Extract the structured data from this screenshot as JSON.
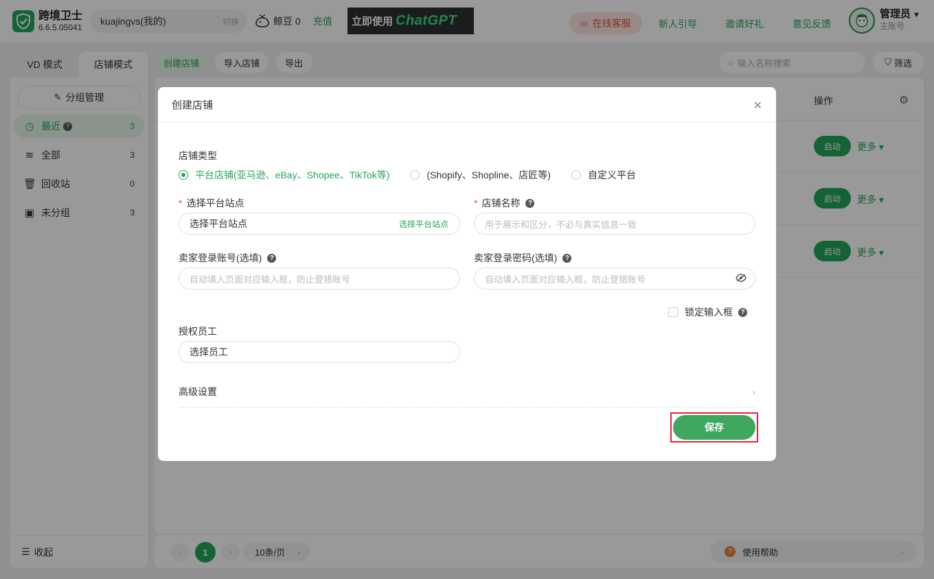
{
  "app": {
    "name": "跨境卫士",
    "version": "6.6.5.05041"
  },
  "account": {
    "name": "kuajingvs(我的)",
    "switch_label": "切换"
  },
  "whale": {
    "label": "鲸豆 0",
    "recharge": "充值"
  },
  "banner": {
    "prefix": "立即使用",
    "brand": "ChatGPT"
  },
  "header": {
    "service_label": "在线客服",
    "guide_label": "新人引导",
    "invite_label": "邀请好礼",
    "feedback_label": "意见反馈",
    "user_name": "管理员",
    "user_role": "主账号"
  },
  "mode_tabs": [
    {
      "label": "VD 模式"
    },
    {
      "label": "店铺模式"
    }
  ],
  "sidebar": {
    "group_manage": "分组管理",
    "items": [
      {
        "label": "最近",
        "count": "3"
      },
      {
        "label": "全部",
        "count": "3"
      },
      {
        "label": "回收站",
        "count": "0"
      },
      {
        "label": "未分组",
        "count": "3"
      }
    ],
    "collapse_label": "收起"
  },
  "toolbar": {
    "create_label": "创建店铺",
    "import_label": "导入店铺",
    "export_label": "导出",
    "search_placeholder": "输入名称搜索",
    "filter_label": "筛选"
  },
  "table": {
    "op_header": "操作",
    "rows": [
      {
        "start": "启动",
        "more": "更多"
      },
      {
        "start": "启动",
        "more": "更多"
      },
      {
        "start": "启动",
        "more": "更多"
      }
    ]
  },
  "pager": {
    "current": "1",
    "per_page": "10条/页",
    "help_label": "使用帮助"
  },
  "modal": {
    "title": "创建店铺",
    "store_type_label": "店铺类型",
    "store_types": [
      "平台店铺(亚马逊、eBay、Shopee、TikTok等)",
      "(Shopify、Shopline、店匠等)",
      "自定义平台"
    ],
    "site_label": "选择平台站点",
    "site_value": "选择平台站点",
    "site_suffix": "选择平台站点",
    "store_name_label": "店铺名称",
    "store_name_placeholder": "用于展示和区分，不必与真实信息一致",
    "seller_account_label": "卖家登录账号(选填)",
    "seller_account_placeholder": "自动填入页面对应输入框，防止登错账号",
    "seller_password_label": "卖家登录密码(选填)",
    "seller_password_placeholder": "自动填入页面对应输入框，防止登错账号",
    "lock_input_label": "锁定输入框",
    "staff_label": "授权员工",
    "staff_value": "选择员工",
    "advanced_label": "高级设置",
    "save_label": "保存"
  }
}
